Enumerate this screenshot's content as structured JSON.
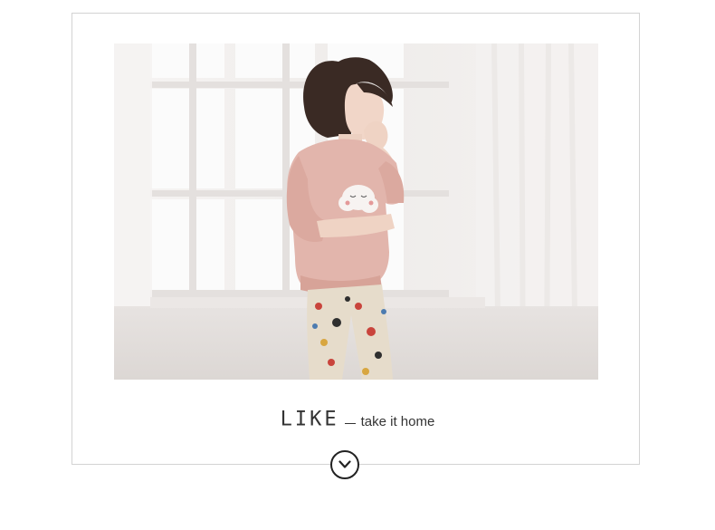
{
  "caption": {
    "title": "LIKE",
    "subtitle": "take it home"
  },
  "photo": {
    "subject": "woman-in-pink-pajama-top",
    "icon": "product-photo"
  },
  "scroll_button": {
    "icon": "chevron-down-icon"
  },
  "colors": {
    "frame_border": "#d3d3d3",
    "text": "#333333",
    "top_pink": "#e2b5ac",
    "pants_beige": "#e6dccb"
  }
}
